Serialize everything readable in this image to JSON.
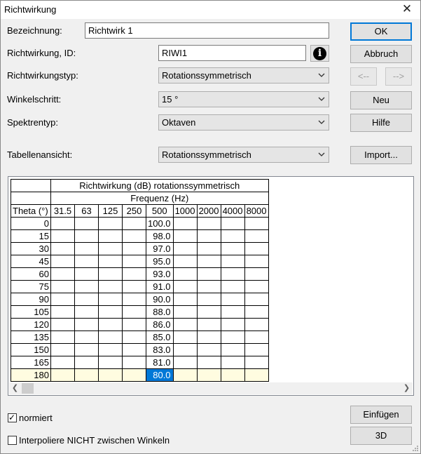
{
  "window": {
    "title": "Richtwirkung"
  },
  "fields": {
    "bezeichnung_label": "Bezeichnung:",
    "bezeichnung_value": "Richtwirk 1",
    "id_label": "Richtwirkung, ID:",
    "id_value": "RIWI1",
    "typ_label": "Richtwirkungstyp:",
    "typ_value": "Rotationssymmetrisch",
    "winkel_label": "Winkelschritt:",
    "winkel_value": "15 °",
    "spektren_label": "Spektrentyp:",
    "spektren_value": "Oktaven",
    "tabelle_label": "Tabellenansicht:",
    "tabelle_value": "Rotationssymmetrisch"
  },
  "buttons": {
    "ok": "OK",
    "abbruch": "Abbruch",
    "prev": "<--",
    "next": "-->",
    "neu": "Neu",
    "hilfe": "Hilfe",
    "import": "Import...",
    "einfuegen": "Einfügen",
    "threed": "3D"
  },
  "table": {
    "title": "Richtwirkung (dB) rotationssymmetrisch",
    "subtitle": "Frequenz (Hz)",
    "theta_header": "Theta (°)",
    "freqs": [
      "31.5",
      "63",
      "125",
      "250",
      "500",
      "1000",
      "2000",
      "4000",
      "8000"
    ],
    "rows": [
      {
        "theta": "0",
        "v500": "100.0"
      },
      {
        "theta": "15",
        "v500": "98.0"
      },
      {
        "theta": "30",
        "v500": "97.0"
      },
      {
        "theta": "45",
        "v500": "95.0"
      },
      {
        "theta": "60",
        "v500": "93.0"
      },
      {
        "theta": "75",
        "v500": "91.0"
      },
      {
        "theta": "90",
        "v500": "90.0"
      },
      {
        "theta": "105",
        "v500": "88.0"
      },
      {
        "theta": "120",
        "v500": "86.0"
      },
      {
        "theta": "135",
        "v500": "85.0"
      },
      {
        "theta": "150",
        "v500": "83.0"
      },
      {
        "theta": "165",
        "v500": "81.0"
      },
      {
        "theta": "180",
        "v500": "80.0"
      }
    ]
  },
  "checkboxes": {
    "normiert_label": "normiert",
    "normiert_checked": true,
    "interp_label": "Interpoliere NICHT zwischen Winkeln",
    "interp_checked": false
  },
  "icons": {
    "close": "close-icon",
    "info": "info-icon",
    "dropdown": "chevron-down-icon",
    "scroll_left": "chevron-left-icon",
    "scroll_right": "chevron-right-icon",
    "check": "check-icon",
    "resize": "resize-grip-icon"
  },
  "colors": {
    "accent": "#0078d7",
    "selected_row": "#fffce0",
    "background": "#f0f0f0"
  }
}
